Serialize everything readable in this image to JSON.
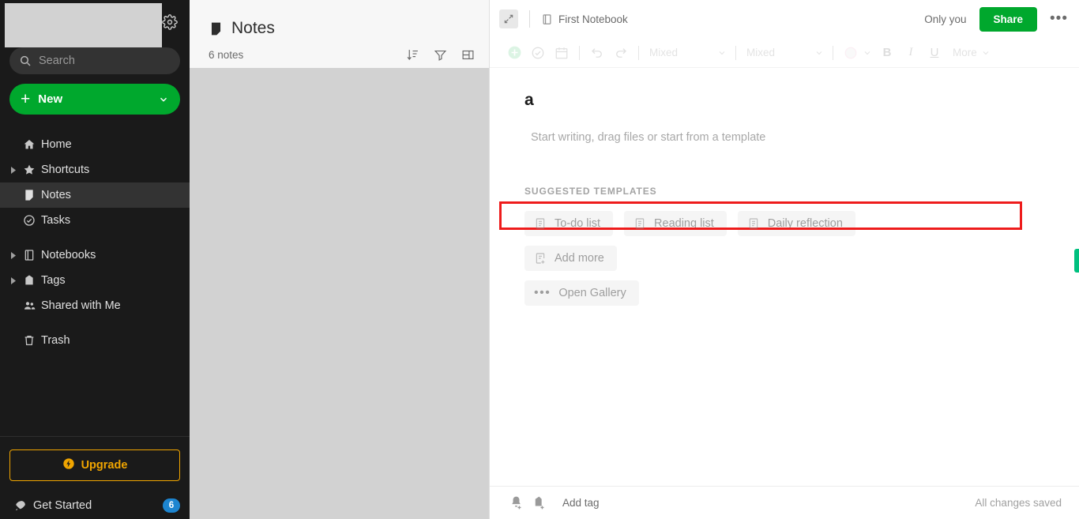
{
  "sidebar": {
    "account_placeholder": "",
    "settings_icon": "gear-icon",
    "search": {
      "placeholder": "Search",
      "icon": "search-icon"
    },
    "new_button": {
      "label": "New",
      "icon": "plus-icon",
      "chevron": "chevron-down-icon",
      "color": "#00a82d"
    },
    "nav_items": [
      {
        "label": "Home",
        "icon": "home-icon",
        "expandable": false,
        "active": false
      },
      {
        "label": "Shortcuts",
        "icon": "star-icon",
        "expandable": true,
        "active": false
      },
      {
        "label": "Notes",
        "icon": "note-icon",
        "expandable": false,
        "active": true
      },
      {
        "label": "Tasks",
        "icon": "check-circle-icon",
        "expandable": false,
        "active": false
      }
    ],
    "nav_items_2": [
      {
        "label": "Notebooks",
        "icon": "notebook-icon",
        "expandable": true,
        "active": false
      },
      {
        "label": "Tags",
        "icon": "tag-icon",
        "expandable": true,
        "active": false
      },
      {
        "label": "Shared with Me",
        "icon": "people-icon",
        "expandable": false,
        "active": false
      }
    ],
    "nav_items_3": [
      {
        "label": "Trash",
        "icon": "trash-icon",
        "expandable": false,
        "active": false
      }
    ],
    "upgrade": {
      "label": "Upgrade",
      "icon": "bolt-icon",
      "color": "#f0a500"
    },
    "get_started": {
      "label": "Get Started",
      "icon": "rocket-icon",
      "badge": "6",
      "badge_color": "#1d85d0"
    }
  },
  "notelist": {
    "title": "Notes",
    "title_icon": "note-icon",
    "count": "6 notes",
    "actions": [
      {
        "name": "sort-icon"
      },
      {
        "name": "filter-icon"
      },
      {
        "name": "view-layout-icon"
      }
    ]
  },
  "editor": {
    "topbar": {
      "expand_icon": "expand-arrows-icon",
      "notebook_icon": "notebook-star-icon",
      "notebook_name": "First Notebook",
      "visibility": "Only you",
      "share_label": "Share",
      "more_label": "•••"
    },
    "toolbar": {
      "items": [
        {
          "name": "insert-plus-icon",
          "type": "icon"
        },
        {
          "name": "task-icon",
          "type": "icon"
        },
        {
          "name": "calendar-icon",
          "type": "icon"
        },
        {
          "name": "separator-1",
          "type": "sep"
        },
        {
          "name": "undo-icon",
          "type": "icon"
        },
        {
          "name": "redo-icon",
          "type": "icon"
        },
        {
          "name": "separator-2",
          "type": "sep"
        },
        {
          "name": "font-family-select",
          "type": "select",
          "value": "Mixed"
        },
        {
          "name": "separator-3",
          "type": "sep"
        },
        {
          "name": "font-size-select",
          "type": "select",
          "value": "Mixed"
        },
        {
          "name": "separator-4",
          "type": "sep"
        },
        {
          "name": "text-color-picker",
          "type": "color"
        },
        {
          "name": "bold-button",
          "type": "text",
          "value": "B"
        },
        {
          "name": "italic-button",
          "type": "text",
          "value": "I"
        },
        {
          "name": "underline-button",
          "type": "text",
          "value": "U"
        },
        {
          "name": "more-formatting-button",
          "type": "more",
          "value": "More"
        }
      ]
    },
    "note": {
      "title": "a",
      "body_placeholder": "Start writing, drag files or start from a template"
    },
    "templates": {
      "heading": "SUGGESTED TEMPLATES",
      "row1": [
        {
          "label": "To-do list",
          "icon": "template-doc-icon"
        },
        {
          "label": "Reading list",
          "icon": "template-doc-icon"
        },
        {
          "label": "Daily reflection",
          "icon": "template-doc-icon"
        }
      ],
      "row2": [
        {
          "label": "Add more",
          "icon": "template-add-icon"
        }
      ],
      "row3": [
        {
          "label": "Open Gallery",
          "icon": "ellipsis-icon"
        }
      ]
    },
    "footer": {
      "reminder_icon": "bell-plus-icon",
      "tag_icon": "tag-plus-icon",
      "add_tag_label": "Add tag",
      "status": "All changes saved"
    },
    "side_handle_color": "#00c07f"
  },
  "annotation": {
    "color": "#ee1c1c",
    "target": "note-body-placeholder"
  }
}
